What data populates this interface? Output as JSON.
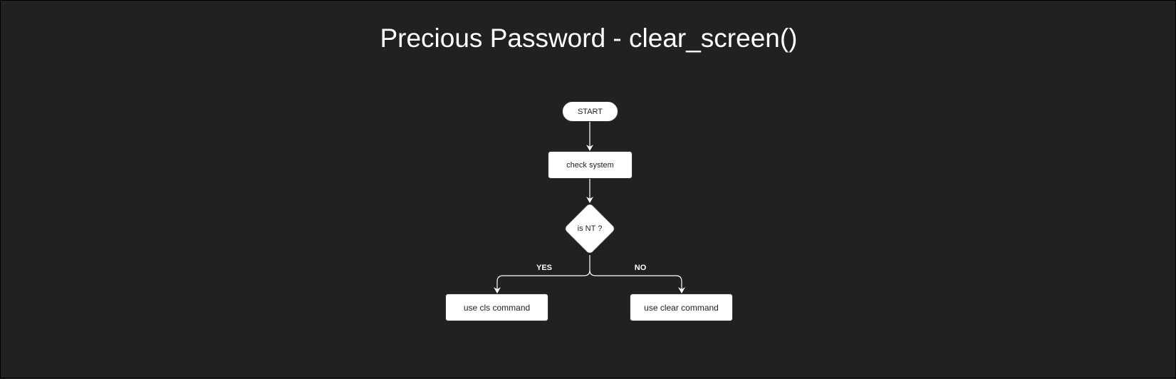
{
  "title": "Precious Password - clear_screen()",
  "nodes": {
    "start": "START",
    "check": "check system",
    "decision": "is NT ?",
    "yes_action": "use cls command",
    "no_action": "use clear command"
  },
  "edges": {
    "yes": "YES",
    "no": "NO"
  }
}
